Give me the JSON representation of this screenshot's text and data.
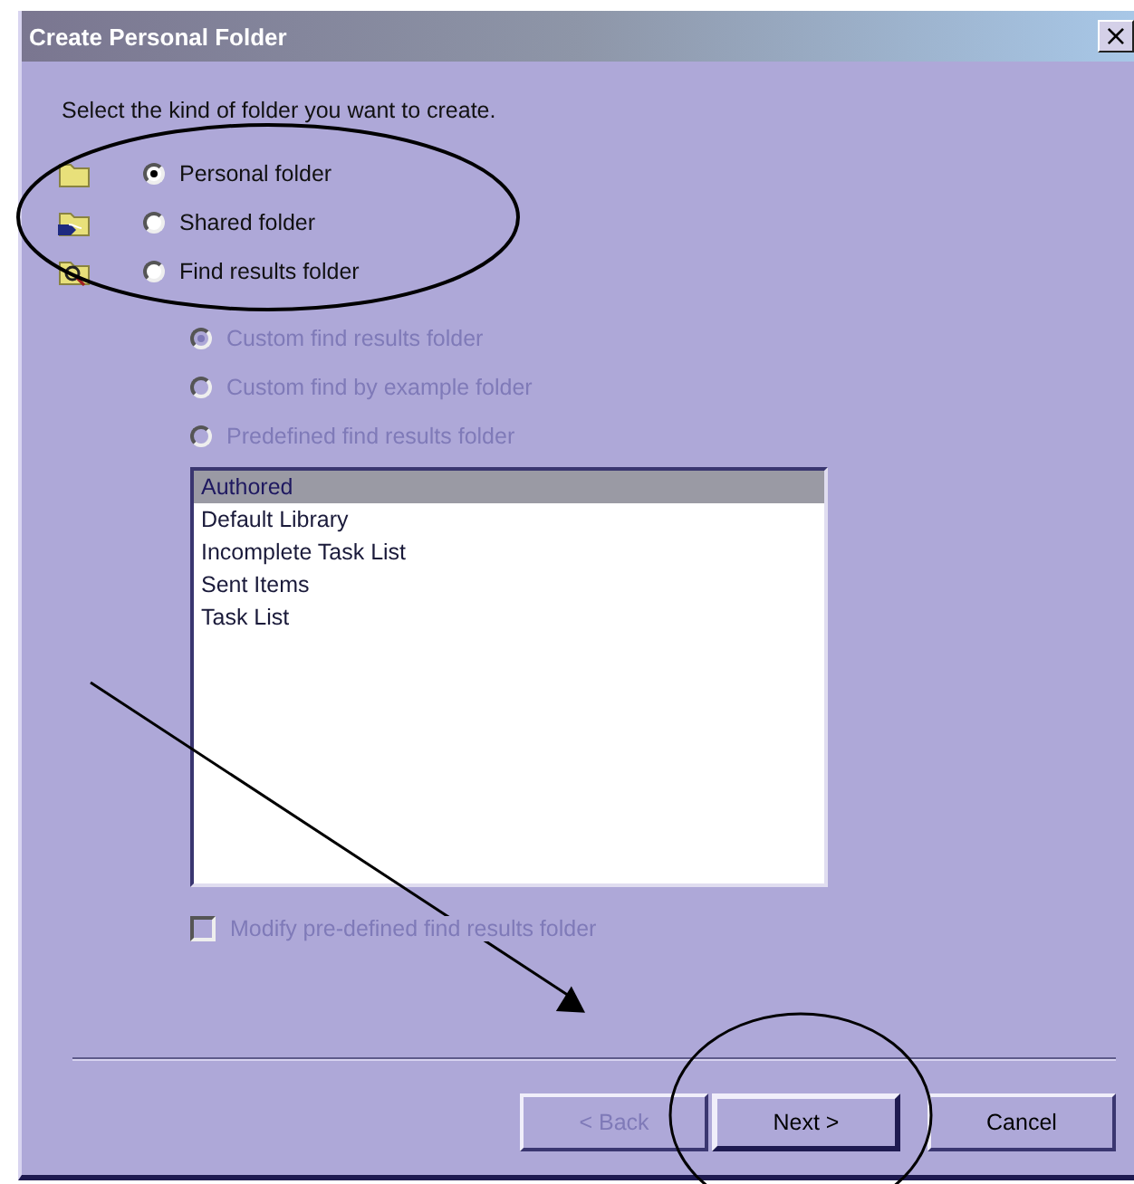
{
  "window": {
    "title": "Create Personal Folder",
    "close": "×"
  },
  "prompt": "Select the kind of folder you want to create.",
  "folder_types": [
    {
      "kind": "personal",
      "label": "Personal folder",
      "selected": true
    },
    {
      "kind": "shared",
      "label": "Shared folder",
      "selected": false
    },
    {
      "kind": "find",
      "label": "Find results folder",
      "selected": false
    }
  ],
  "find_options": [
    {
      "label": "Custom find results folder",
      "selected": true,
      "disabled": true
    },
    {
      "label": "Custom find by example folder",
      "selected": false,
      "disabled": true
    },
    {
      "label": "Predefined find results folder",
      "selected": false,
      "disabled": true
    }
  ],
  "predefined_list": [
    {
      "label": "Authored",
      "selected": true
    },
    {
      "label": "Default Library",
      "selected": false
    },
    {
      "label": "Incomplete Task List",
      "selected": false
    },
    {
      "label": "Sent Items",
      "selected": false
    },
    {
      "label": "Task List",
      "selected": false
    }
  ],
  "modify_checkbox": {
    "label": "Modify pre-defined find results folder",
    "checked": false,
    "disabled": true
  },
  "buttons": [
    {
      "label": "< Back",
      "disabled": true,
      "default": false
    },
    {
      "label": "Next >",
      "disabled": false,
      "default": true
    },
    {
      "label": "Cancel",
      "disabled": false,
      "default": false
    }
  ]
}
